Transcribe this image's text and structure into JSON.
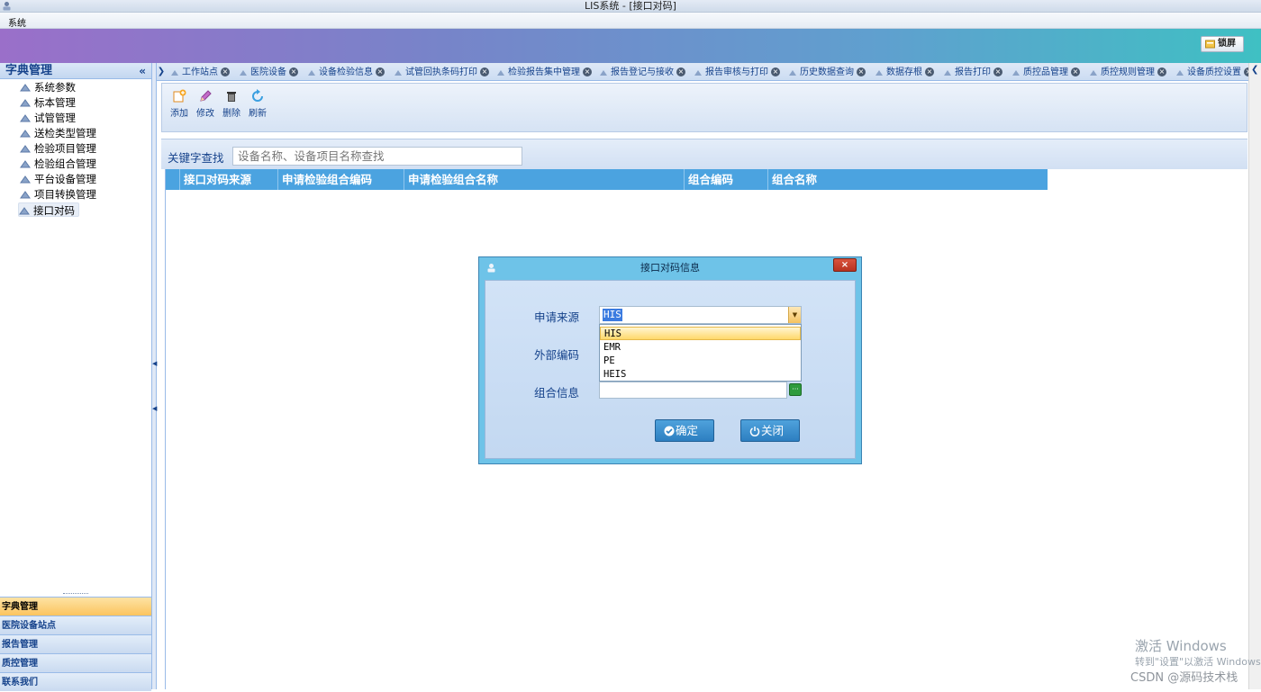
{
  "window": {
    "title": "LIS系统 - [接口对码]"
  },
  "menu": {
    "system": "系统"
  },
  "banner": {
    "lock_label": "锁屏"
  },
  "sidebar": {
    "title": "字典管理",
    "collapse": "«",
    "items": [
      {
        "label": "系统参数"
      },
      {
        "label": "标本管理"
      },
      {
        "label": "试管管理"
      },
      {
        "label": "送检类型管理"
      },
      {
        "label": "检验项目管理"
      },
      {
        "label": "检验组合管理"
      },
      {
        "label": "平台设备管理"
      },
      {
        "label": "项目转换管理"
      },
      {
        "label": "接口对码",
        "selected": true
      }
    ],
    "accordion": [
      {
        "label": "字典管理",
        "active": true
      },
      {
        "label": "医院设备站点"
      },
      {
        "label": "报告管理"
      },
      {
        "label": "质控管理"
      },
      {
        "label": "联系我们"
      }
    ]
  },
  "tabs": [
    {
      "label": "工作站点"
    },
    {
      "label": "医院设备"
    },
    {
      "label": "设备检验信息"
    },
    {
      "label": "试管回执条码打印"
    },
    {
      "label": "检验报告集中管理"
    },
    {
      "label": "报告登记与接收"
    },
    {
      "label": "报告审核与打印"
    },
    {
      "label": "历史数据查询"
    },
    {
      "label": "数据存根"
    },
    {
      "label": "报告打印"
    },
    {
      "label": "质控品管理"
    },
    {
      "label": "质控规则管理"
    },
    {
      "label": "设备质控设置"
    }
  ],
  "toolbar": {
    "add": "添加",
    "edit": "修改",
    "delete": "删除",
    "refresh": "刷新"
  },
  "search": {
    "label": "关键字查找",
    "placeholder": "设备名称、设备项目名称查找"
  },
  "grid": {
    "columns": [
      "接口对码来源",
      "申请检验组合编码",
      "申请检验组合名称",
      "组合编码",
      "组合名称"
    ]
  },
  "dialog": {
    "title": "接口对码信息",
    "close": "×",
    "source_label": "申请来源",
    "source_value": "HIS",
    "options": [
      "HIS",
      "EMR",
      "PE",
      "HEIS"
    ],
    "external_code_label": "外部编码",
    "group_info_label": "组合信息",
    "ok_label": "确定",
    "close_label": "关闭"
  },
  "watermarks": {
    "windows_title": "激活 Windows",
    "windows_hint": "转到\"设置\"以激活 Windows",
    "csdn": "CSDN @源码技术栈"
  },
  "colors": {
    "grid_header": "#4ba3e0",
    "dialog_frame": "#6ec3e8",
    "accordion_active": "#fcc45e",
    "link_text": "#15428b"
  }
}
